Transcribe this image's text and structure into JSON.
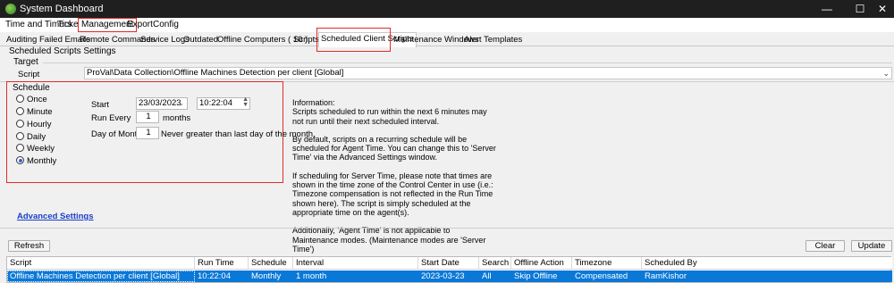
{
  "window": {
    "title": "System Dashboard",
    "min": "—",
    "max": "☐",
    "close": "✕"
  },
  "menu": [
    "Time and Timers",
    "Tickets",
    "Management",
    "Export",
    "Config"
  ],
  "tabs": [
    "Auditing",
    "Failed Emails",
    "Remote Commands",
    "Service Logs",
    "Outdated",
    "Offline Computers ( 10 )",
    "Scripts",
    "Scheduled Client Scripts",
    "Maintenance Windows",
    "Alert Templates"
  ],
  "section_title": "Scheduled Scripts Settings",
  "target": {
    "caption": "Target",
    "script_label": "Script",
    "script_value": "ProVal\\Data Collection\\Offline Machines Detection per client [Global]"
  },
  "schedule": {
    "caption": "Schedule",
    "options": [
      "Once",
      "Minute",
      "Hourly",
      "Daily",
      "Weekly",
      "Monthly"
    ],
    "selected": "Monthly",
    "start_label": "Start",
    "start_date": "23/03/2023",
    "start_time": "10:22:04",
    "run_every_label": "Run Every",
    "run_every_value": "1",
    "run_every_unit": "months",
    "day_of_month_label": "Day of Month",
    "day_of_month_value": "1",
    "day_of_month_note": "Never greater than last day of the month."
  },
  "info": {
    "heading": "Information:",
    "paragraphs": [
      "Scripts scheduled to run within the next 6 minutes may not run until their next scheduled interval.",
      "By default, scripts on a recurring schedule will be scheduled for Agent Time. You can change this to 'Server Time' via the Advanced Settings window.",
      "If scheduling for Server Time, please note that times are shown in the time zone of the Control Center in use (i.e.: Timezone compensation is not reflected in the Run Time shown here). The script is simply scheduled at the appropriate time on the agent(s).",
      "Additionally, 'Agent Time' is not applicable to Maintenance modes. (Maintenance modes are 'Server Time')"
    ]
  },
  "advanced_settings_label": "Advanced Settings",
  "buttons": {
    "refresh": "Refresh",
    "clear": "Clear",
    "update": "Update"
  },
  "grid": {
    "columns": [
      "Script",
      "Run Time",
      "Schedule",
      "Interval",
      "Start Date",
      "Search",
      "Offline Action",
      "Timezone",
      "Scheduled By"
    ],
    "rows": [
      [
        "Offline Machines Detection per client [Global]",
        "10:22:04",
        "Monthly",
        "1 month",
        "2023-03-23",
        "All",
        "Skip Offline",
        "Compensated",
        "RamKishor"
      ]
    ]
  },
  "colors": {
    "highlight_red": "#e32a2a",
    "selection_blue": "#0a78d7",
    "link_blue": "#1a3ec9"
  }
}
